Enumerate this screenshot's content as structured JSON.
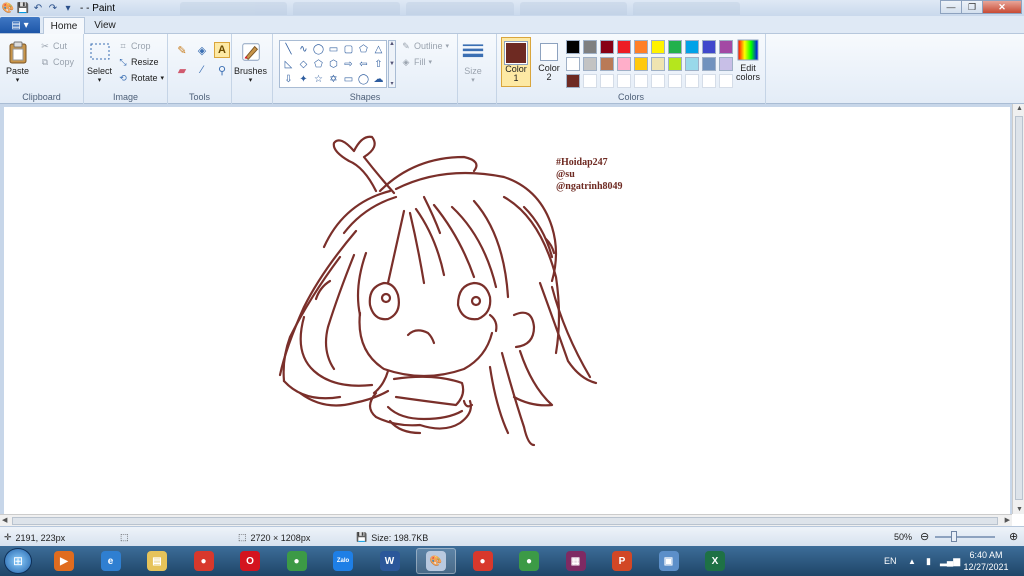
{
  "window": {
    "title": "- - Paint",
    "buttons": {
      "minimize": "—",
      "maximize": "❐",
      "close": "✕"
    }
  },
  "ribbon_tabs": {
    "file_label": "▤ ▾",
    "home_label": "Home",
    "view_label": "View"
  },
  "clipboard": {
    "paste_label": "Paste",
    "cut_label": "Cut",
    "copy_label": "Copy",
    "group_label": "Clipboard"
  },
  "image": {
    "select_label": "Select",
    "crop_label": "Crop",
    "resize_label": "Resize",
    "rotate_label": "Rotate",
    "group_label": "Image"
  },
  "tools": {
    "group_label": "Tools",
    "brushes_label": "Brushes"
  },
  "shapes": {
    "outline_label": "Outline",
    "fill_label": "Fill",
    "size_label": "Size",
    "group_label": "Shapes"
  },
  "colors": {
    "color1_label": "Color 1",
    "color2_label": "Color 2",
    "edit_colors_label": "Edit colors",
    "group_label": "Colors",
    "color1_value": "#6e2a22",
    "color2_value": "#ffffff",
    "palette": [
      "#000000",
      "#7f7f7f",
      "#880015",
      "#ed1c24",
      "#ff7f27",
      "#fff200",
      "#22b14c",
      "#00a2e8",
      "#3f48cc",
      "#a349a4",
      "#ffffff",
      "#c3c3c3",
      "#b97a57",
      "#ffaec9",
      "#ffc90e",
      "#efe4b0",
      "#b5e61d",
      "#99d9ea",
      "#7092be",
      "#c8bfe7",
      "#6e2a22"
    ]
  },
  "canvas": {
    "signature": [
      "#Hoidap247",
      "@su",
      "@ngatrinh8049"
    ],
    "stroke_color": "#7a2f2a"
  },
  "status": {
    "cursor_pos": "2191, 223px",
    "image_size": "2720 × 1208px",
    "file_size": "Size: 198.7KB",
    "zoom": "50%"
  },
  "taskbar": {
    "apps": [
      {
        "name": "media-player",
        "color": "#e06c1f",
        "glyph": "▶"
      },
      {
        "name": "internet-explorer",
        "color": "#2f7fd1",
        "glyph": "e"
      },
      {
        "name": "file-explorer",
        "color": "#e6c35a",
        "glyph": "▤"
      },
      {
        "name": "chrome",
        "color": "#d8382c",
        "glyph": "●"
      },
      {
        "name": "opera",
        "color": "#d4141f",
        "glyph": "O"
      },
      {
        "name": "chrome-profile",
        "color": "#3c9a46",
        "glyph": "●"
      },
      {
        "name": "zalo",
        "color": "#1e7fe6",
        "glyph": "Zalo"
      },
      {
        "name": "word",
        "color": "#2b579a",
        "glyph": "W"
      },
      {
        "name": "paint",
        "color": "#b9c9df",
        "glyph": "🎨"
      },
      {
        "name": "chrome-2",
        "color": "#d8382c",
        "glyph": "●"
      },
      {
        "name": "chrome-3",
        "color": "#3c9a46",
        "glyph": "●"
      },
      {
        "name": "winrar",
        "color": "#7e2a63",
        "glyph": "▦"
      },
      {
        "name": "powerpoint",
        "color": "#d24726",
        "glyph": "P"
      },
      {
        "name": "control-panel",
        "color": "#5c8fc9",
        "glyph": "▣"
      },
      {
        "name": "excel",
        "color": "#1e7145",
        "glyph": "X"
      }
    ],
    "language": "EN",
    "time": "6:40 AM",
    "date": "12/27/2021"
  }
}
